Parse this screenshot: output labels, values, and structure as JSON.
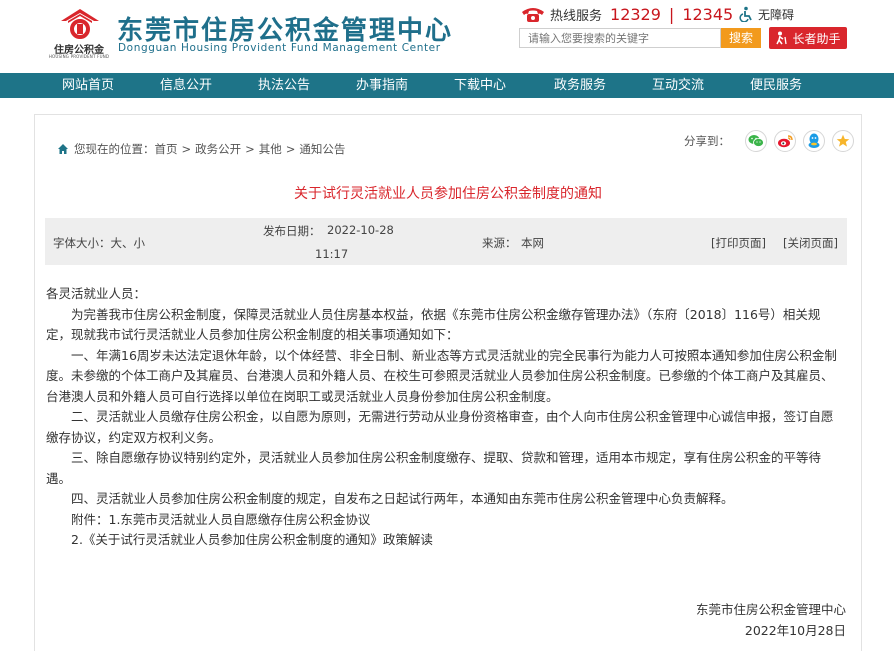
{
  "header": {
    "logo_caption": "住房公积金",
    "logo_caption_en": "HOUSING PROVIDENT FUND",
    "site_title": "东莞市住房公积金管理中心",
    "site_title_en": "Dongguan Housing Provident Fund Management Center",
    "hotline_label": "热线服务",
    "hotline_1": "12329",
    "hotline_sep": "|",
    "hotline_2": "12345",
    "accessibility_label": "无障碍",
    "search_placeholder": "请输入您要搜索的关键字",
    "search_button": "搜索",
    "elder_button": "长者助手"
  },
  "nav": {
    "items": [
      "网站首页",
      "信息公开",
      "执法公告",
      "办事指南",
      "下载中心",
      "政务服务",
      "互动交流",
      "便民服务"
    ]
  },
  "breadcrumb": {
    "prefix": "您现在的位置：",
    "items": [
      "首页",
      "政务公开",
      "其他",
      "通知公告"
    ],
    "separator": ">"
  },
  "share": {
    "label": "分享到："
  },
  "article": {
    "title": "关于试行灵活就业人员参加住房公积金制度的通知",
    "font_size_label": "字体大小：",
    "font_size_options": "大、小",
    "date_label": "发布日期：",
    "date": "2022-10-28",
    "time": "11:17",
    "source_label": "来源：",
    "source": "本网",
    "print_link": "[打印页面]",
    "close_link": "[关闭页面]",
    "paragraphs": [
      "各灵活就业人员：",
      "为完善我市住房公积金制度，保障灵活就业人员住房基本权益，依据《东莞市住房公积金缴存管理办法》（东府〔2018〕116号）相关规定，现就我市试行灵活就业人员参加住房公积金制度的相关事项通知如下：",
      "一、年满16周岁未达法定退休年龄，以个体经营、非全日制、新业态等方式灵活就业的完全民事行为能力人可按照本通知参加住房公积金制度。未参缴的个体工商户及其雇员、台港澳人员和外籍人员、在校生可参照灵活就业人员参加住房公积金制度。已参缴的个体工商户及其雇员、台港澳人员和外籍人员可自行选择以单位在岗职工或灵活就业人员身份参加住房公积金制度。",
      "二、灵活就业人员缴存住房公积金，以自愿为原则，无需进行劳动从业身份资格审查，由个人向市住房公积金管理中心诚信申报，签订自愿缴存协议，约定双方权利义务。",
      "三、除自愿缴存协议特别约定外，灵活就业人员参加住房公积金制度缴存、提取、贷款和管理，适用本市规定，享有住房公积金的平等待遇。",
      "四、灵活就业人员参加住房公积金制度的规定，自发布之日起试行两年，本通知由东莞市住房公积金管理中心负责解释。",
      "附件：1.东莞市灵活就业人员自愿缴存住房公积金协议",
      "2.《关于试行灵活就业人员参加住房公积金制度的通知》政策解读"
    ],
    "signature_org": "东莞市住房公积金管理中心",
    "signature_date": "2022年10月28日"
  },
  "colors": {
    "brand_teal": "#1e7488",
    "title_red": "#d9262c",
    "hotline_red": "#c8161d",
    "search_orange": "#f29a1d"
  }
}
